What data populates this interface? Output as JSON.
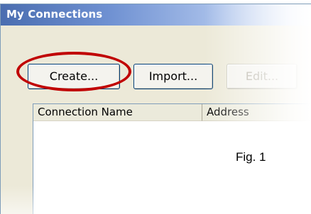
{
  "window": {
    "title": "My Connections"
  },
  "toolbar": {
    "create_label": "Create...",
    "import_label": "Import...",
    "edit_label": "Edit..."
  },
  "list": {
    "columns": [
      "Connection Name",
      "Address"
    ]
  },
  "caption": "Fig. 1",
  "colors": {
    "title_bar": "#4a6db0",
    "highlight": "#c00000",
    "window_bg": "#ece9d8"
  }
}
